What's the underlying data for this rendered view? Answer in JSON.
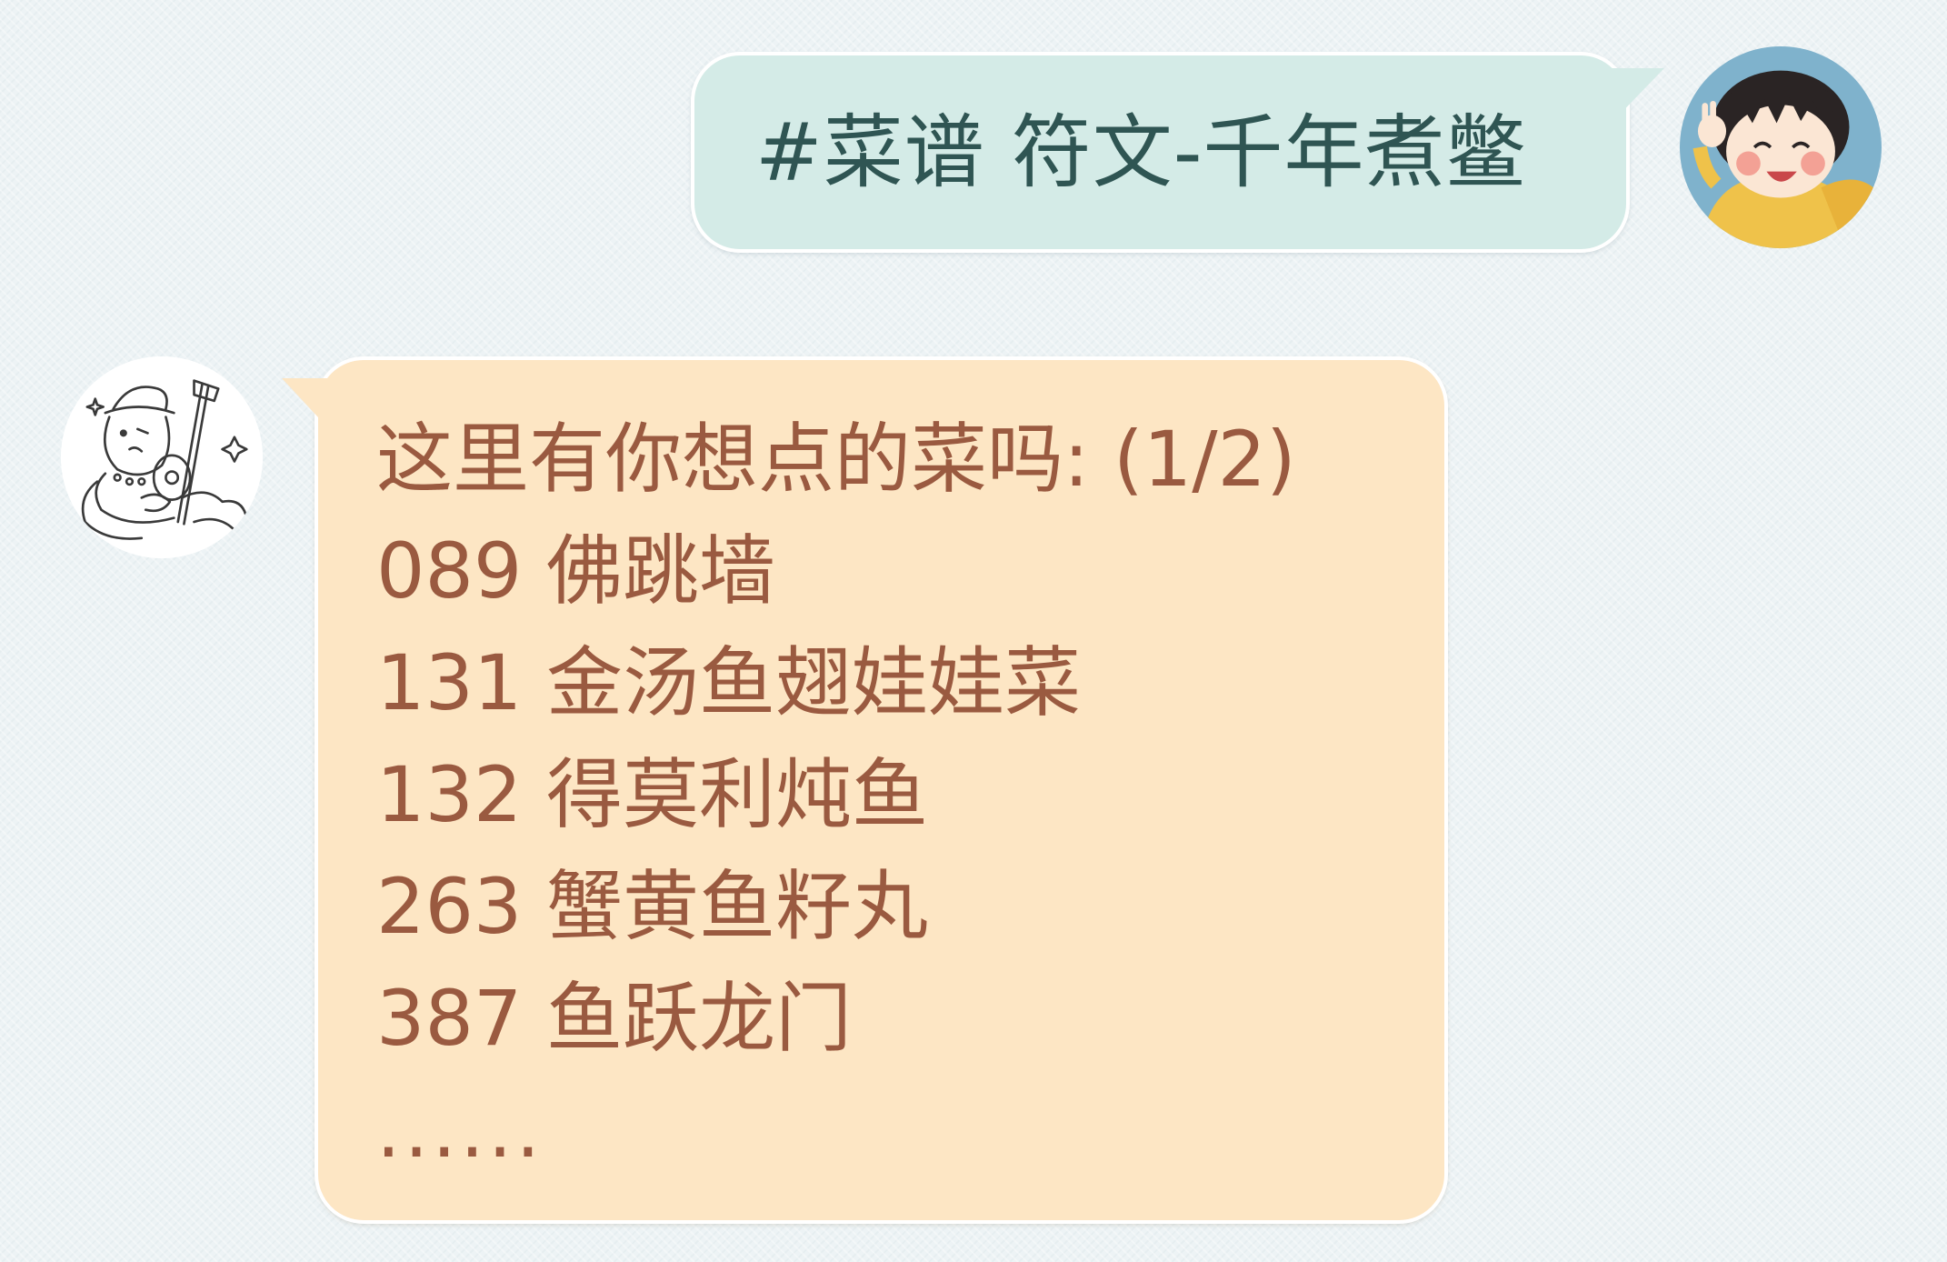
{
  "messages": {
    "outgoing": {
      "text": "#菜谱 符文-千年煮鳖",
      "avatar_icon": "cartoon-girl-avatar",
      "bubble_color": "#d4ebe7",
      "text_color": "#2f5553"
    },
    "incoming": {
      "avatar_icon": "sketch-character-with-instrument-avatar",
      "bubble_color": "#fde6c4",
      "text_color": "#9a5a40",
      "lines": [
        "这里有你想点的菜吗: (1/2)",
        "089 佛跳墙",
        "131 金汤鱼翅娃娃菜",
        "132 得莫利炖鱼",
        "263 蟹黄鱼籽丸",
        "387 鱼跃龙门",
        "......"
      ]
    }
  },
  "colors": {
    "background": "#edf3f5"
  }
}
